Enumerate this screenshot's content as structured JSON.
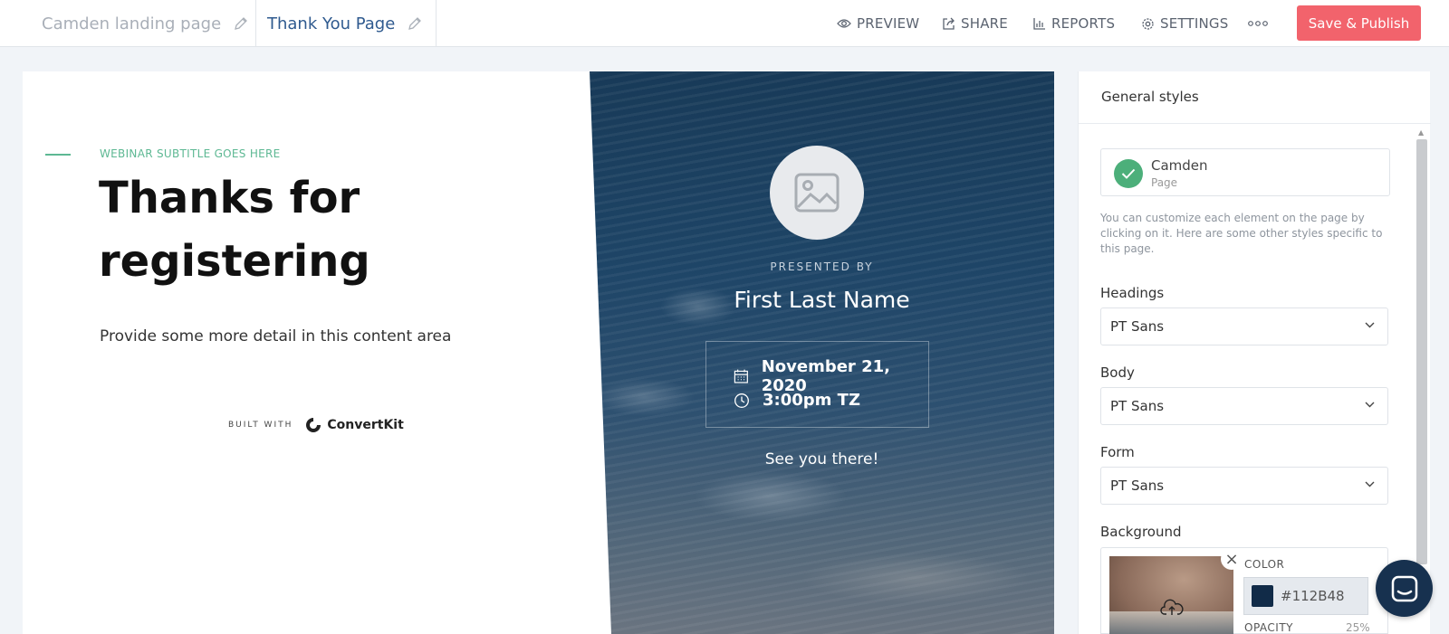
{
  "header": {
    "page_tabs": [
      {
        "label": "Camden landing page"
      },
      {
        "label": "Thank You Page"
      }
    ],
    "nav": {
      "preview": "PREVIEW",
      "share": "SHARE",
      "reports": "REPORTS",
      "settings": "SETTINGS"
    },
    "publish_label": "Save & Publish"
  },
  "canvas": {
    "subtitle": "WEBINAR SUBTITLE GOES HERE",
    "heading": "Thanks for registering",
    "body": "Provide some more detail in this content area",
    "built_with": "BUILT WITH",
    "brand": "ConvertKit",
    "hero": {
      "presented_by": "PRESENTED BY",
      "presenter": "First Last Name",
      "date": "November 21, 2020",
      "time": "3:00pm TZ",
      "closing": "See you there!"
    }
  },
  "panel": {
    "title": "General styles",
    "theme": {
      "name": "Camden",
      "type": "Page"
    },
    "help": "You can customize each element on the page by clicking on it. Here are some other styles specific to this page.",
    "headings": {
      "label": "Headings",
      "value": "PT Sans"
    },
    "body": {
      "label": "Body",
      "value": "PT Sans"
    },
    "form": {
      "label": "Form",
      "value": "PT Sans"
    },
    "background": {
      "label": "Background",
      "color_label": "COLOR",
      "color_value": "#112B48",
      "opacity_label": "OPACITY",
      "opacity_value": "25%"
    }
  },
  "colors": {
    "accent": "#5db893",
    "publish": "#f2636c",
    "hero_bg": "#112B48"
  },
  "icons": [
    "pencil-icon",
    "eye-icon",
    "share-icon",
    "bar-chart-icon",
    "gear-icon",
    "more-icon",
    "image-placeholder-icon",
    "calendar-icon",
    "clock-icon",
    "check-icon",
    "chevron-down-icon",
    "upload-icon",
    "close-icon",
    "chat-icon",
    "convertkit-logo-icon"
  ]
}
